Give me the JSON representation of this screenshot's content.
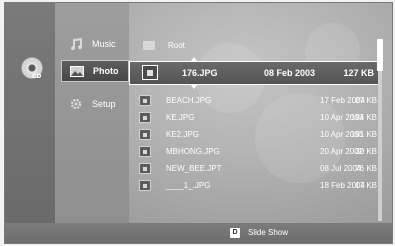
{
  "menu": {
    "items": [
      {
        "label": "Music",
        "icon": "music-icon"
      },
      {
        "label": "Photo",
        "icon": "photo-icon"
      },
      {
        "label": "Setup",
        "icon": "setup-icon"
      }
    ]
  },
  "disc": {
    "label": "CD",
    "icon": "cd-disc-icon"
  },
  "browser": {
    "root_label": "Root",
    "selected": {
      "name": "176.JPG",
      "date": "08 Feb 2003",
      "size": "127 KB"
    },
    "files": [
      {
        "name": "BEACH.JPG",
        "date": "17 Feb 2004",
        "size": "27 KB"
      },
      {
        "name": "KE.JPG",
        "date": "10 Apr 2003",
        "size": "194 KB"
      },
      {
        "name": "KE2.JPG",
        "date": "10 Apr 2003",
        "size": "191 KB"
      },
      {
        "name": "MBHONG.JPG",
        "date": "20 Apr 2002",
        "size": "30 KB"
      },
      {
        "name": "NEW_BEE.JPT",
        "date": "08 Jul 2004",
        "size": "76 KB"
      },
      {
        "name": "____1_.JPG",
        "date": "18 Feb 2004",
        "size": "17 KB"
      }
    ]
  },
  "footer": {
    "key": "D",
    "hint": "Slide Show"
  }
}
